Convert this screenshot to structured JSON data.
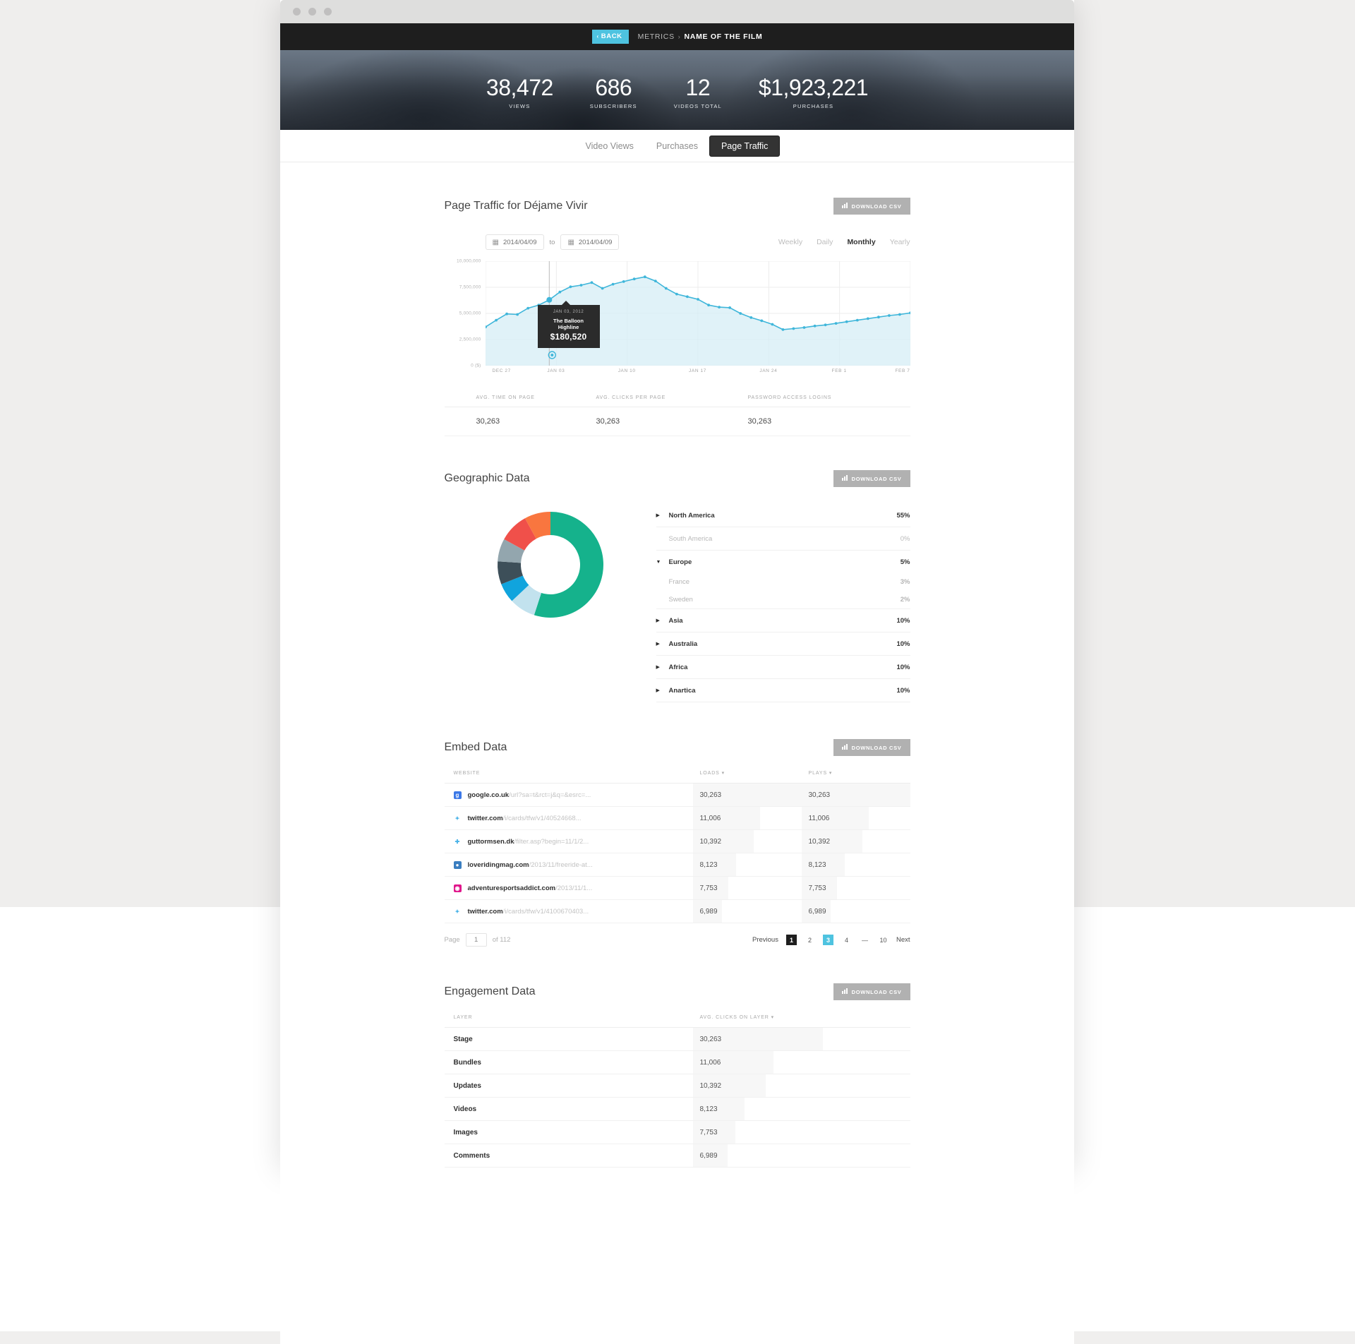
{
  "topbar": {
    "back_label": "BACK",
    "back_chevron": "‹",
    "breadcrumb_root": "METRICS",
    "breadcrumb_sep": "›",
    "breadcrumb_current": "NAME OF THE FILM"
  },
  "hero": {
    "stats": [
      {
        "value": "38,472",
        "label": "VIEWS"
      },
      {
        "value": "686",
        "label": "SUBSCRIBERS"
      },
      {
        "value": "12",
        "label": "VIDEOS TOTAL"
      },
      {
        "value": "$1,923,221",
        "label": "PURCHASES"
      }
    ]
  },
  "tabs": [
    {
      "label": "Video Views",
      "active": false
    },
    {
      "label": "Purchases",
      "active": false
    },
    {
      "label": "Page Traffic",
      "active": true
    }
  ],
  "page_traffic": {
    "title": "Page Traffic for Déjame Vivir",
    "download_label": "DOWNLOAD CSV",
    "date_from": "2014/04/09",
    "date_to": "2014/04/09",
    "to_label": "to",
    "granularity": [
      "Weekly",
      "Daily",
      "Monthly",
      "Yearly"
    ],
    "granularity_active": "Monthly",
    "tooltip": {
      "date": "JAN 03, 2012",
      "title": "The Balloon Highline",
      "value": "$180,520"
    },
    "strip": {
      "headers": [
        "AVG. TIME ON PAGE",
        "AVG. CLICKS PER PAGE",
        "PASSWORD ACCESS LOGINS"
      ],
      "values": [
        "30,263",
        "30,263",
        "30,263"
      ]
    }
  },
  "chart_data": {
    "type": "area",
    "title": "Page Traffic for Déjame Vivir",
    "xlabel": "",
    "ylabel": "0 ($)",
    "ylim": [
      0,
      10000000
    ],
    "ytick_labels": [
      "10,000,000",
      "7,500,000",
      "5,000,000",
      "2,500,000",
      "0 ($)"
    ],
    "ytick_values": [
      10000000,
      7500000,
      5000000,
      2500000,
      0
    ],
    "xtick_labels": [
      "DEC 27",
      "JAN 03",
      "JAN 10",
      "JAN 17",
      "JAN 24",
      "FEB 1",
      "FEB 7"
    ],
    "grid": true,
    "legend": "none",
    "line_color": "#3fb6da",
    "fill_color": "#d6eef6",
    "highlight_index": 6,
    "annotation": "JAN 03, 2012 — The Balloon Highline — $180,520",
    "values": [
      3700000,
      4350000,
      4950000,
      4900000,
      5500000,
      5800000,
      6300000,
      7050000,
      7550000,
      7700000,
      7950000,
      7400000,
      7800000,
      8050000,
      8300000,
      8500000,
      8100000,
      7400000,
      6850000,
      6600000,
      6350000,
      5800000,
      5600000,
      5550000,
      5000000,
      4600000,
      4300000,
      3950000,
      3450000,
      3550000,
      3650000,
      3800000,
      3900000,
      4050000,
      4200000,
      4350000,
      4500000,
      4650000,
      4800000,
      4900000,
      5050000
    ]
  },
  "geographic": {
    "title": "Geographic Data",
    "download_label": "DOWNLOAD CSV",
    "rows": [
      {
        "name": "North America",
        "value": "55%",
        "tri": "▶",
        "muted": false,
        "sub": []
      },
      {
        "name": "South America",
        "value": "0%",
        "tri": "",
        "muted": true,
        "sub": []
      },
      {
        "name": "Europe",
        "value": "5%",
        "tri": "▼",
        "muted": false,
        "sub": [
          {
            "name": "France",
            "value": "3%"
          },
          {
            "name": "Sweden",
            "value": "2%"
          }
        ]
      },
      {
        "name": "Asia",
        "value": "10%",
        "tri": "▶",
        "muted": false,
        "sub": []
      },
      {
        "name": "Australia",
        "value": "10%",
        "tri": "▶",
        "muted": false,
        "sub": []
      },
      {
        "name": "Africa",
        "value": "10%",
        "tri": "▶",
        "muted": false,
        "sub": []
      },
      {
        "name": "Anartica",
        "value": "10%",
        "tri": "▶",
        "muted": false,
        "sub": []
      }
    ],
    "donut": {
      "type": "pie",
      "labels": [
        "North America",
        "Light Blue",
        "Blue",
        "Dark Slate",
        "Grey Blue",
        "Red",
        "Orange"
      ],
      "values": [
        55,
        8,
        6,
        7,
        7,
        9,
        8
      ],
      "colors": [
        "#15b28c",
        "#c2e2ee",
        "#10a4dd",
        "#3d4f59",
        "#93a6ae",
        "#f0504a",
        "#f9763f"
      ]
    }
  },
  "embed": {
    "title": "Embed Data",
    "download_label": "DOWNLOAD CSV",
    "columns": [
      "WEBSITE",
      "LOADS",
      "PLAYS"
    ],
    "sort_glyph": "▾",
    "rows": [
      {
        "icon": "google-icon",
        "icon_char": "g",
        "icon_bg": "#3b78e7",
        "domain": "google.co.uk",
        "path": "/url?sa=t&rct=j&q=&esrc=...",
        "loads": "30,263",
        "plays": "30,263",
        "loads_pct": 100,
        "plays_pct": 100
      },
      {
        "icon": "twitter-icon",
        "icon_char": "✦",
        "icon_bg": "transparent",
        "domain": "twitter.com",
        "path": "/i/cards/tfw/v1/40524668...",
        "loads": "11,006",
        "plays": "11,006",
        "loads_pct": 62,
        "plays_pct": 62
      },
      {
        "icon": "plus-icon",
        "icon_char": "✚",
        "icon_bg": "transparent",
        "domain": "guttormsen.dk",
        "path": "/filter.asp?begin=11/1/2...",
        "loads": "10,392",
        "plays": "10,392",
        "loads_pct": 56,
        "plays_pct": 56
      },
      {
        "icon": "globe-icon",
        "icon_char": "●",
        "icon_bg": "#3a7ec0",
        "domain": "loveridingmag.com",
        "path": "/2013/11/freeride-at...",
        "loads": "8,123",
        "plays": "8,123",
        "loads_pct": 40,
        "plays_pct": 40
      },
      {
        "icon": "camera-icon",
        "icon_char": "◉",
        "icon_bg": "#e0168b",
        "domain": "adventuresportsaddict.com",
        "path": "/2013/11/1...",
        "loads": "7,753",
        "plays": "7,753",
        "loads_pct": 33,
        "plays_pct": 33
      },
      {
        "icon": "twitter-icon",
        "icon_char": "✦",
        "icon_bg": "transparent",
        "domain": "twitter.com",
        "path": "/i/cards/tfw/v1/4100670403...",
        "loads": "6,989",
        "plays": "6,989",
        "loads_pct": 27,
        "plays_pct": 27
      }
    ],
    "pagination": {
      "page_label": "Page",
      "page_value": "1",
      "of_label": "of 112",
      "previous": "Previous",
      "next": "Next",
      "numbers": [
        "1",
        "2",
        "3",
        "4",
        "—",
        "10"
      ],
      "dark_page": "1",
      "active_page": "3"
    }
  },
  "engagement": {
    "title": "Engagement Data",
    "download_label": "DOWNLOAD CSV",
    "columns": [
      "LAYER",
      "AVG. CLICKS ON LAYER"
    ],
    "sort_glyph": "▾",
    "rows": [
      {
        "layer": "Stage",
        "clicks": "30,263",
        "pct": 100
      },
      {
        "layer": "Bundles",
        "clicks": "11,006",
        "pct": 62
      },
      {
        "layer": "Updates",
        "clicks": "10,392",
        "pct": 56
      },
      {
        "layer": "Videos",
        "clicks": "8,123",
        "pct": 40
      },
      {
        "layer": "Images",
        "clicks": "7,753",
        "pct": 33
      },
      {
        "layer": "Comments",
        "clicks": "6,989",
        "pct": 27
      }
    ]
  }
}
